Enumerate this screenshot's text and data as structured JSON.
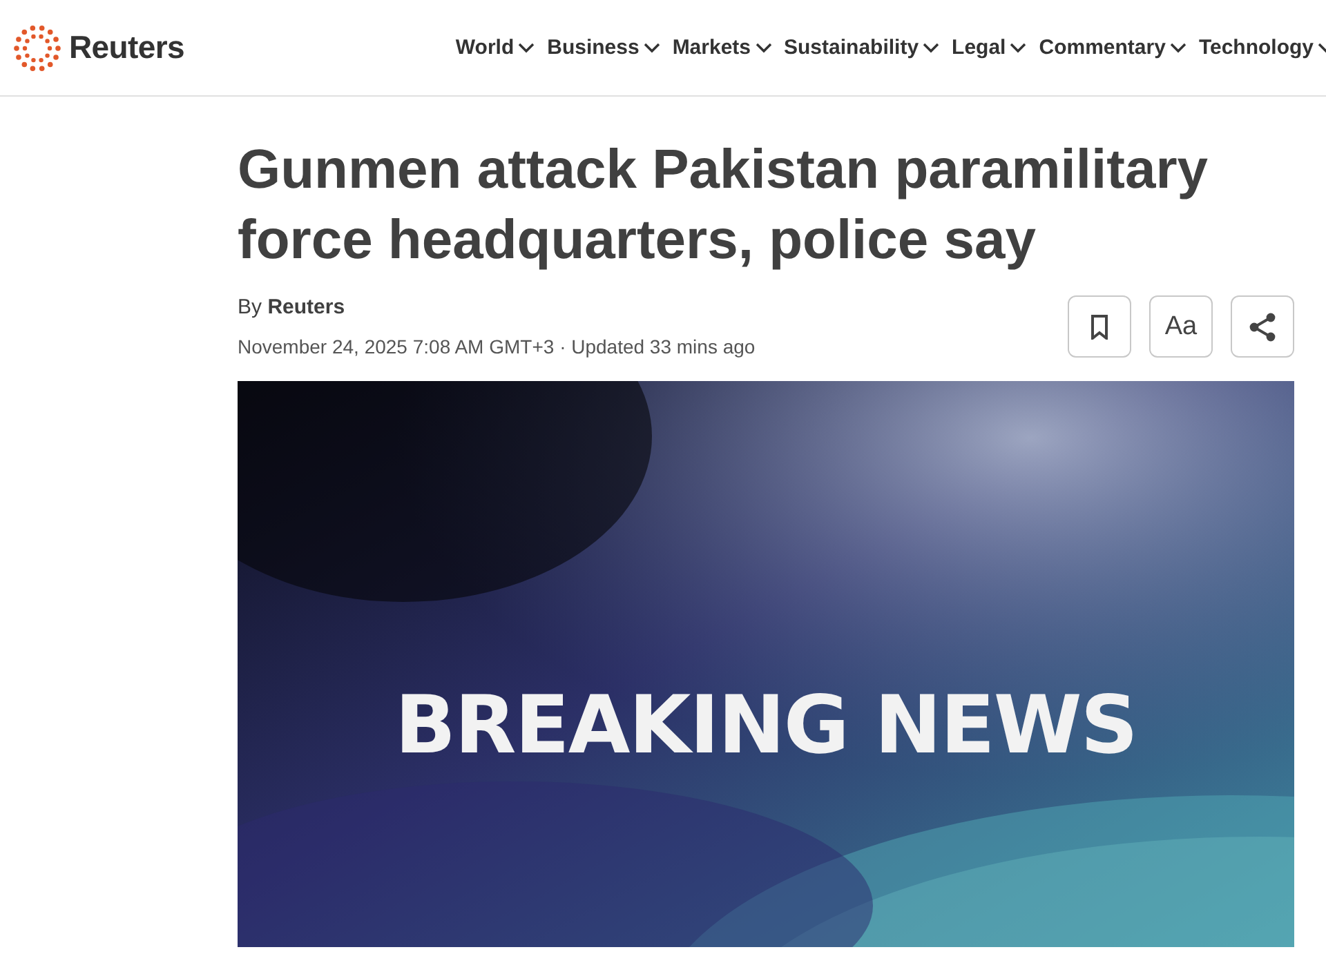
{
  "header": {
    "logo": "Reuters",
    "nav": [
      {
        "label": "World"
      },
      {
        "label": "Business"
      },
      {
        "label": "Markets"
      },
      {
        "label": "Sustainability"
      },
      {
        "label": "Legal"
      },
      {
        "label": "Commentary"
      },
      {
        "label": "Technology"
      }
    ]
  },
  "article": {
    "headline": "Gunmen attack Pakistan paramilitary force headquarters, police say",
    "byline": "By **Reuters**",
    "dateline": "November 24, 2025 7:08 AM GMT+3 · Updated 33 mins ago",
    "tools": [
      {
        "kind": "bookmark"
      },
      {
        "kind": "text",
        "label": "Aa"
      },
      {
        "kind": "share"
      }
    ],
    "image": {
      "kind": "picture",
      "overlay_text": "BREAKING NEWS"
    }
  }
}
